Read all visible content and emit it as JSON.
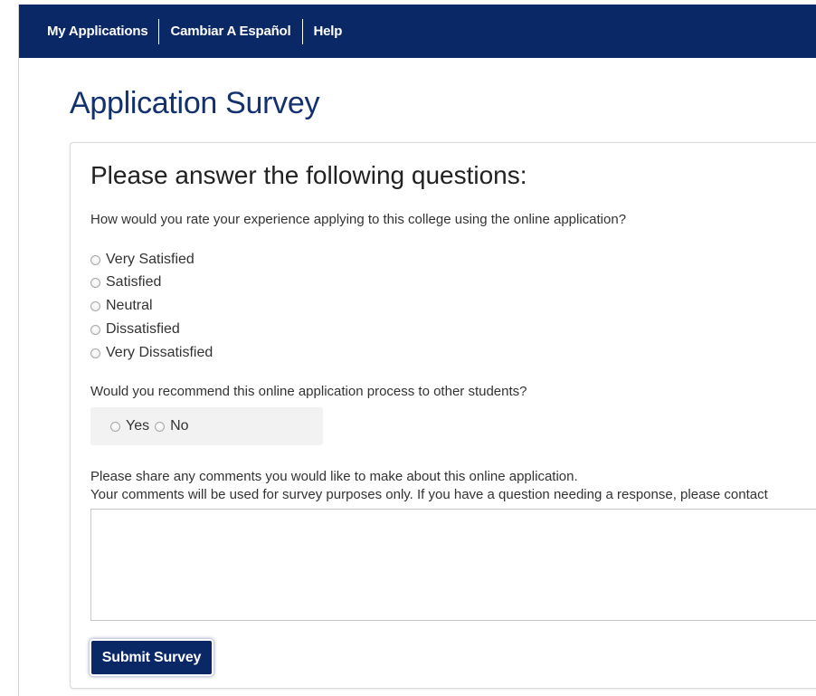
{
  "nav": {
    "items": [
      {
        "label": "My Applications"
      },
      {
        "label": "Cambiar A Español"
      },
      {
        "label": "Help"
      }
    ]
  },
  "page": {
    "title": "Application Survey"
  },
  "panel": {
    "heading": "Please answer the following questions:"
  },
  "question1": {
    "text": "How would you rate your experience applying to this college using the online application?",
    "options": [
      {
        "label": "Very Satisfied"
      },
      {
        "label": "Satisfied"
      },
      {
        "label": "Neutral"
      },
      {
        "label": "Dissatisfied"
      },
      {
        "label": "Very Dissatisfied"
      }
    ]
  },
  "question2": {
    "text": "Would you recommend this online application process to other students?",
    "options": [
      {
        "label": "Yes"
      },
      {
        "label": "No"
      }
    ]
  },
  "comments": {
    "prompt": "Please share any comments you would like to make about this online application.",
    "note": "Your comments will be used for survey purposes only. If you have a question needing a response, please contact",
    "value": ""
  },
  "actions": {
    "submit_label": "Submit Survey"
  }
}
